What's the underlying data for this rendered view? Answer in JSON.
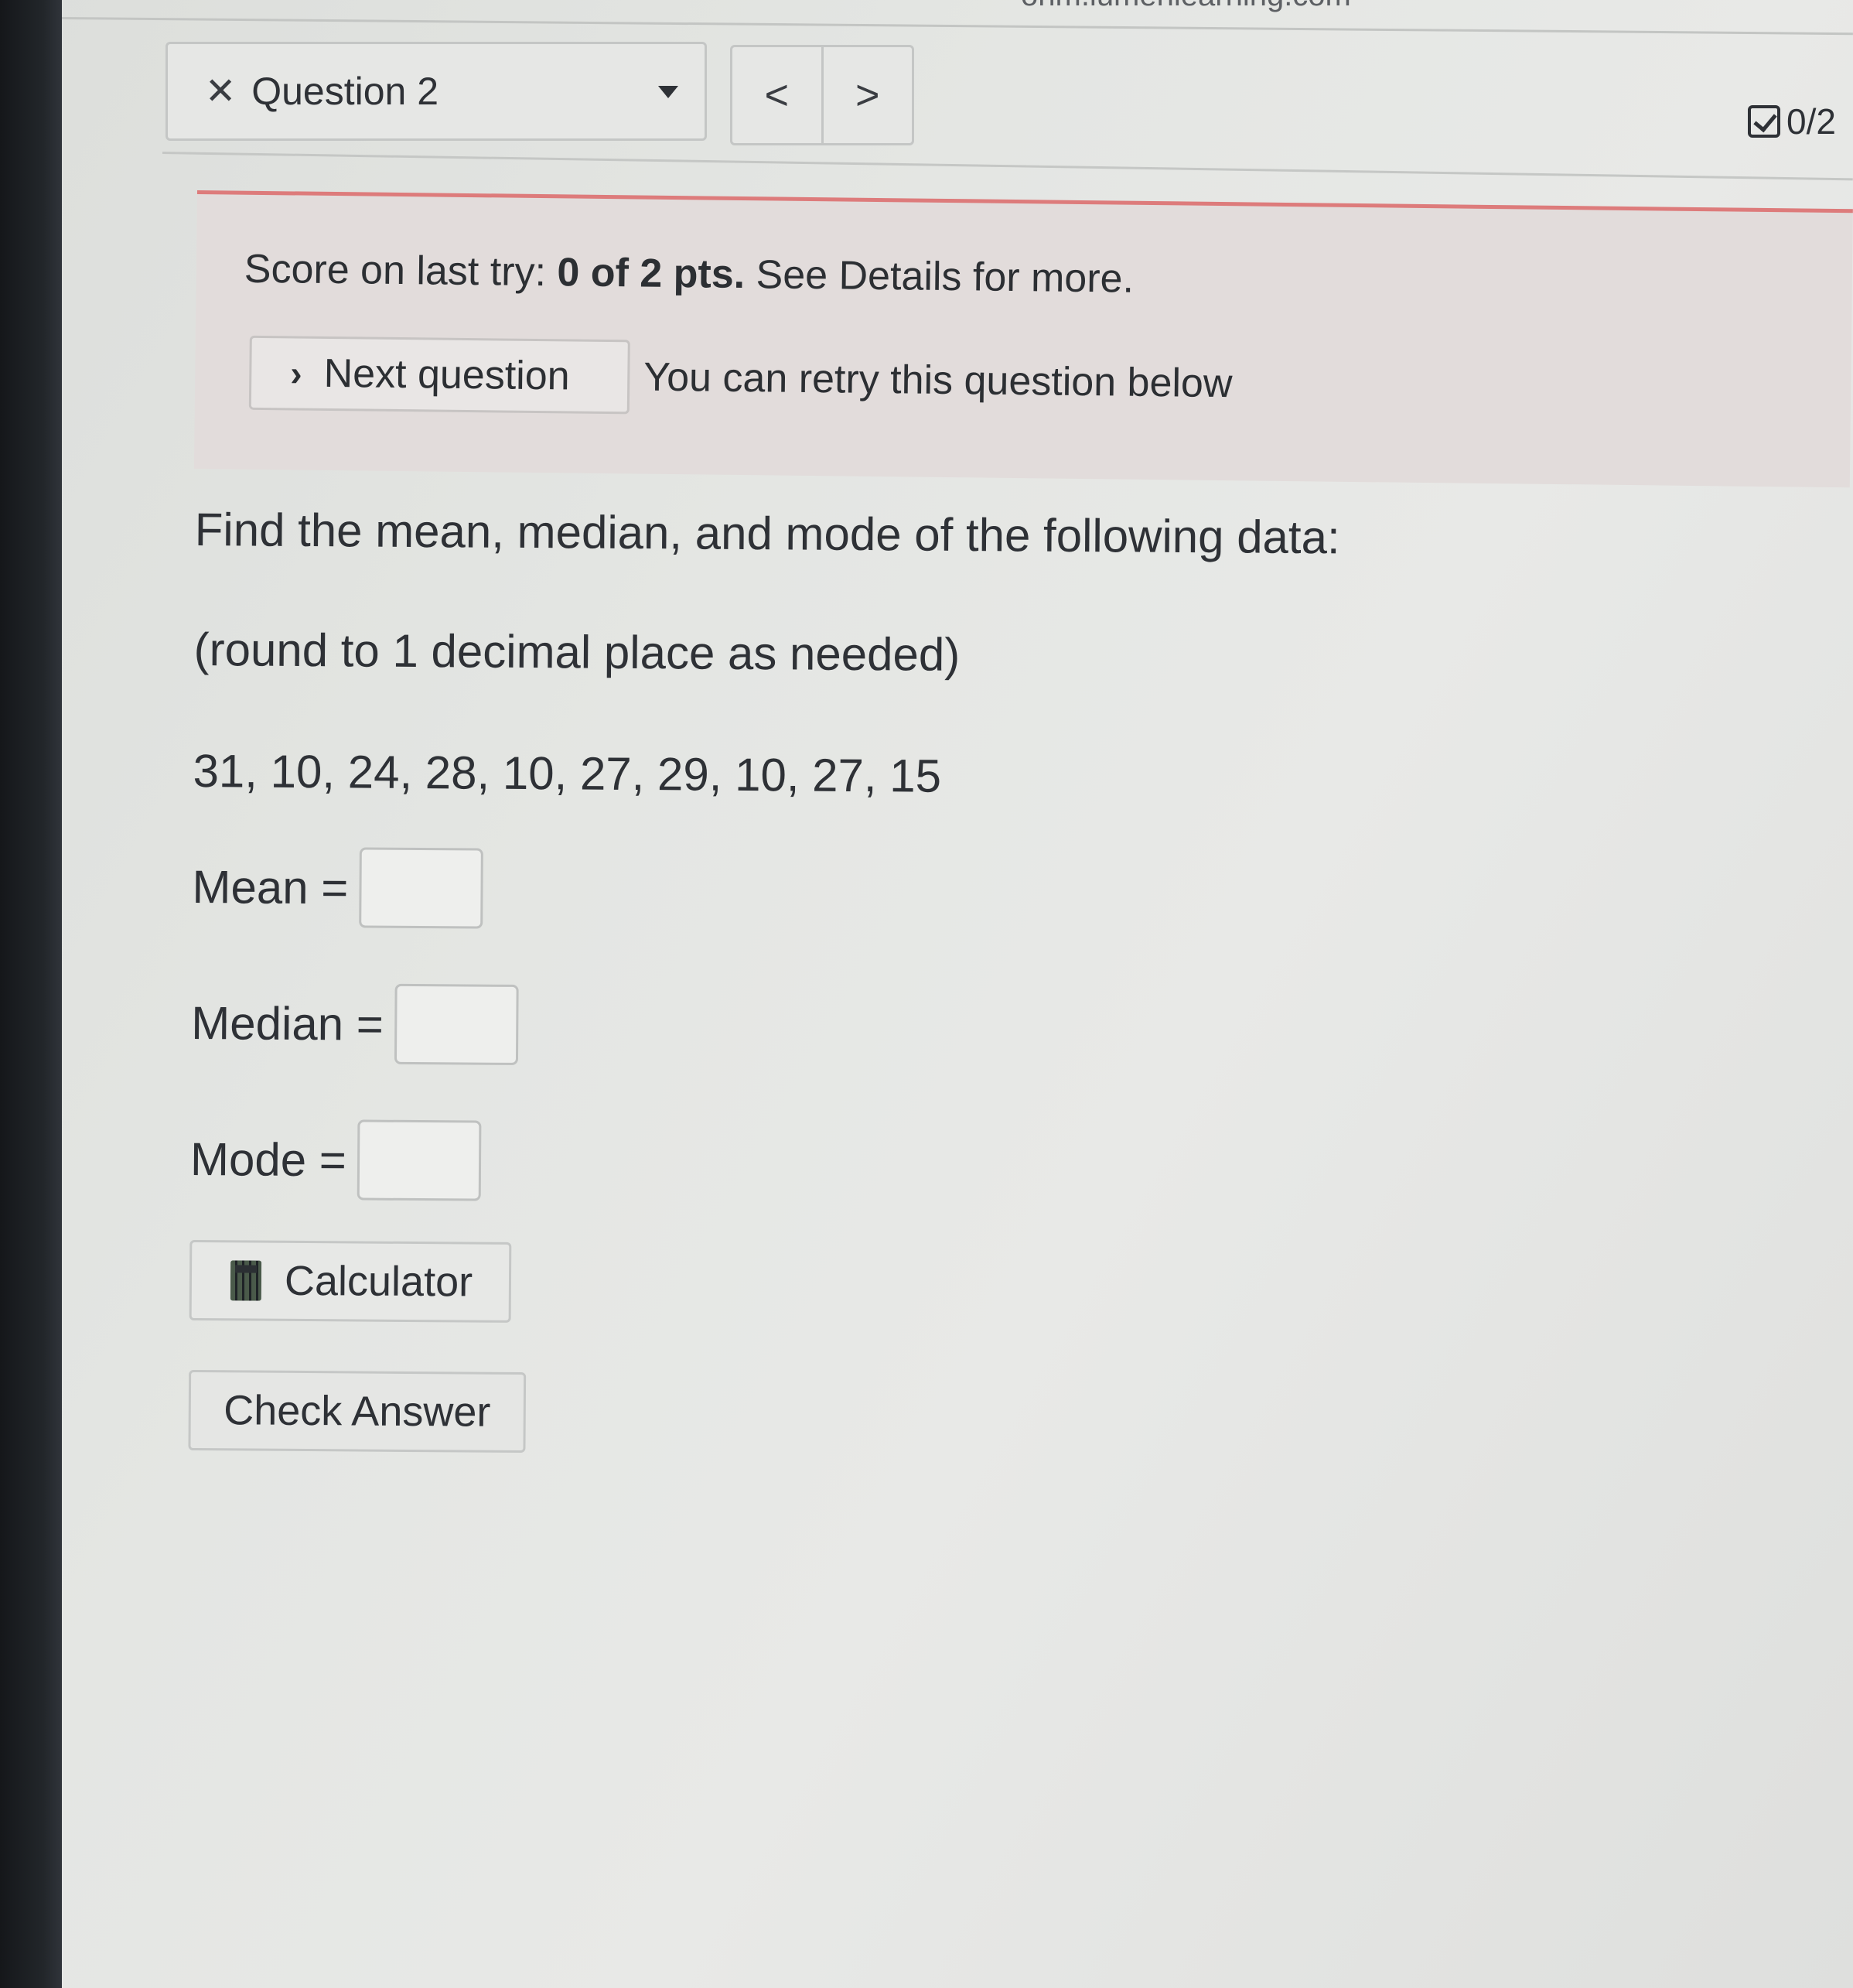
{
  "browser": {
    "url_fragment": "ohm.lumenlearning.com"
  },
  "header": {
    "question_selector": "Question 2",
    "prev_label": "<",
    "next_label": ">",
    "score_badge": "0/2"
  },
  "banner": {
    "score_prefix": "Score on last try:",
    "score_value": "0 of 2 pts.",
    "score_suffix": "See Details for more.",
    "next_button": "Next question",
    "retry_text": "You can retry this question below",
    "accent_color": "#dd7b7b"
  },
  "question": {
    "prompt": "Find the mean, median, and mode of the following data:",
    "instruction": "(round to 1 decimal place as needed)",
    "dataset": "31, 10, 24, 28, 10, 27, 29, 10, 27, 15",
    "fields": {
      "mean_label": "Mean =",
      "median_label": "Median =",
      "mode_label": "Mode ="
    },
    "calculator_button": "Calculator",
    "check_button": "Check Answer"
  }
}
